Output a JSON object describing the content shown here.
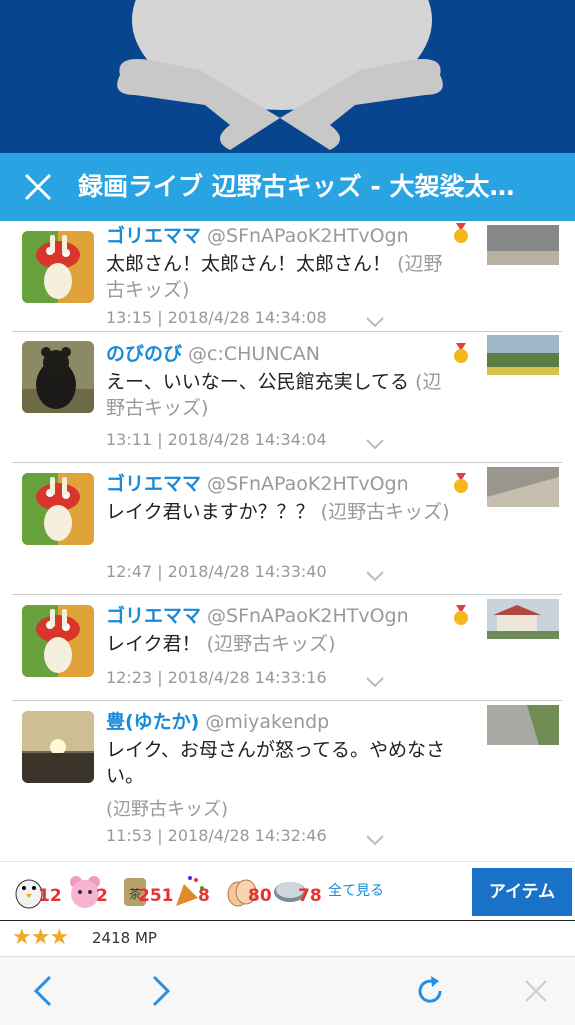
{
  "titlebar": {
    "title": "録画ライブ 辺野古キッズ - 大袈裟太…"
  },
  "comments": [
    {
      "name": "ゴリエママ",
      "id": "@SFnAPaoK2HTvOgn",
      "text": "太郎さん！太郎さん！太郎さん！",
      "tag": "(辺野古キッズ)",
      "meta": "13:15 | 2018/4/28 14:34:08"
    },
    {
      "name": "のびのび",
      "id": "@c:CHUNCAN",
      "text": "えー、いいなー、公民館充実してる",
      "tag": "(辺野古キッズ)",
      "meta": "13:11 | 2018/4/28 14:34:04"
    },
    {
      "name": "ゴリエママ",
      "id": "@SFnAPaoK2HTvOgn",
      "text": "レイク君いますか？？？",
      "tag": "(辺野古キッズ)",
      "meta": "12:47 | 2018/4/28 14:33:40"
    },
    {
      "name": "ゴリエママ",
      "id": "@SFnAPaoK2HTvOgn",
      "text": "レイク君！",
      "tag": "(辺野古キッズ)",
      "meta": "12:23 | 2018/4/28 14:33:16"
    },
    {
      "name": "豊(ゆたか)",
      "id": "@miyakendp",
      "text": "レイク、お母さんが怒ってる。やめなさい。",
      "tag": "(辺野古キッズ)",
      "meta": "11:53 | 2018/4/28 14:32:46"
    }
  ],
  "items": {
    "counts": [
      "12",
      "2",
      "251",
      "8",
      "80",
      "78"
    ],
    "see_all": "全て見る",
    "button": "アイテム"
  },
  "rating": {
    "stars": "★★★",
    "mp": "2418 MP"
  },
  "colors": {
    "hero": "#08458f",
    "titlebar": "#2aa3e3",
    "name": "#1a8ad8",
    "item_button": "#1a72c8",
    "star": "#f1a826"
  }
}
